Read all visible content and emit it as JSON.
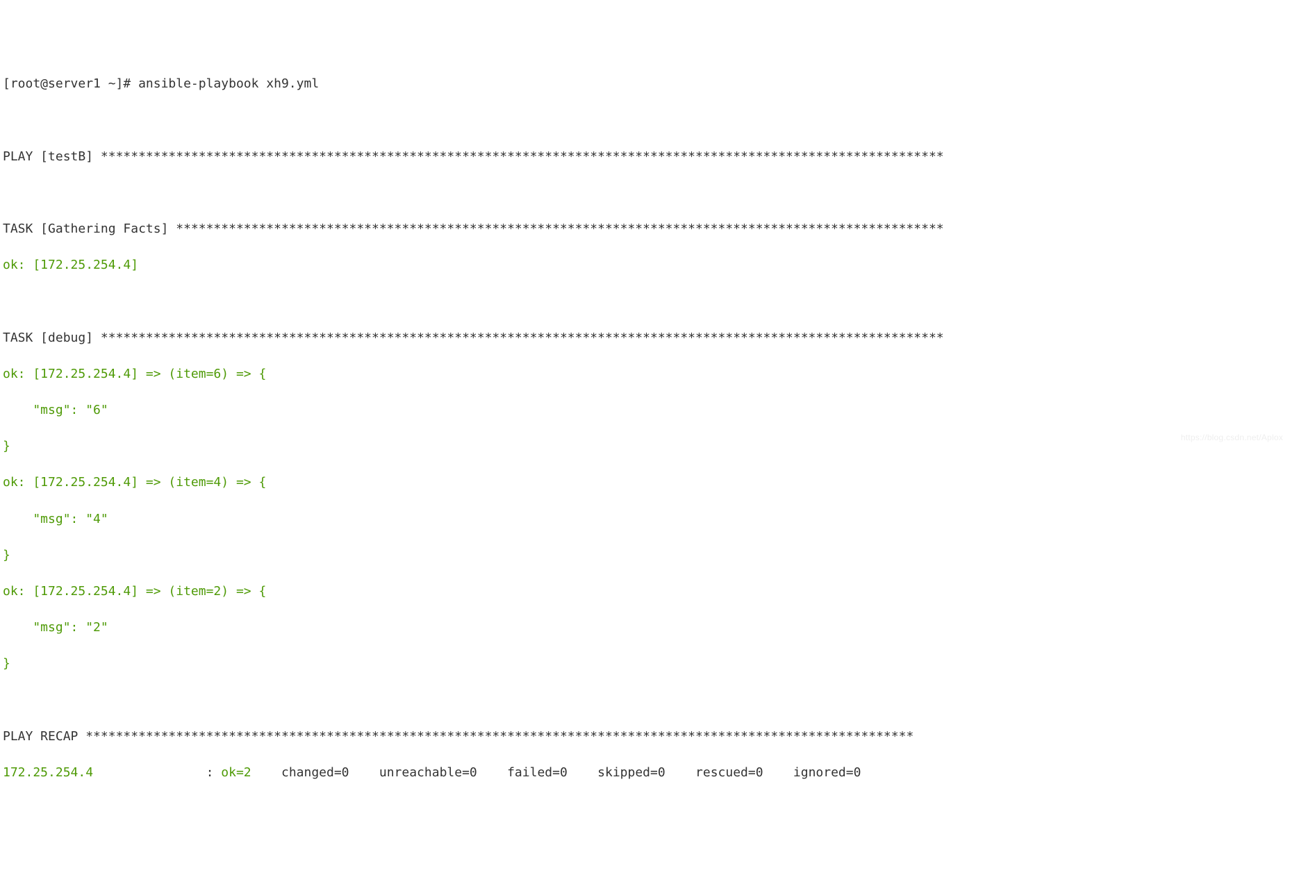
{
  "prompt": "[root@server1 ~]# ansible-playbook xh9.yml",
  "play_header": "PLAY [testB] ",
  "task_gather": {
    "header": "TASK [Gathering Facts] ",
    "ok": "ok: [172.25.254.4]"
  },
  "task_debug": {
    "header": "TASK [debug] ",
    "items": [
      {
        "line1": "ok: [172.25.254.4] => (item=6) => {",
        "line2": "    \"msg\": \"6\"",
        "line3": "}"
      },
      {
        "line1": "ok: [172.25.254.4] => (item=4) => {",
        "line2": "    \"msg\": \"4\"",
        "line3": "}"
      },
      {
        "line1": "ok: [172.25.254.4] => (item=2) => {",
        "line2": "    \"msg\": \"2\"",
        "line3": "}"
      }
    ]
  },
  "recap": {
    "header": "PLAY RECAP ",
    "host": "172.25.254.4",
    "sep_colon": "               : ",
    "ok_label": "ok=2",
    "rest": "    changed=0    unreachable=0    failed=0    skipped=0    rescued=0    ignored=0"
  },
  "stars": {
    "play": "****************************************************************************************************************",
    "gather": "******************************************************************************************************",
    "debug": "****************************************************************************************************************",
    "recap": "**************************************************************************************************************"
  },
  "watermark": "https://blog.csdn.net/Aplox"
}
